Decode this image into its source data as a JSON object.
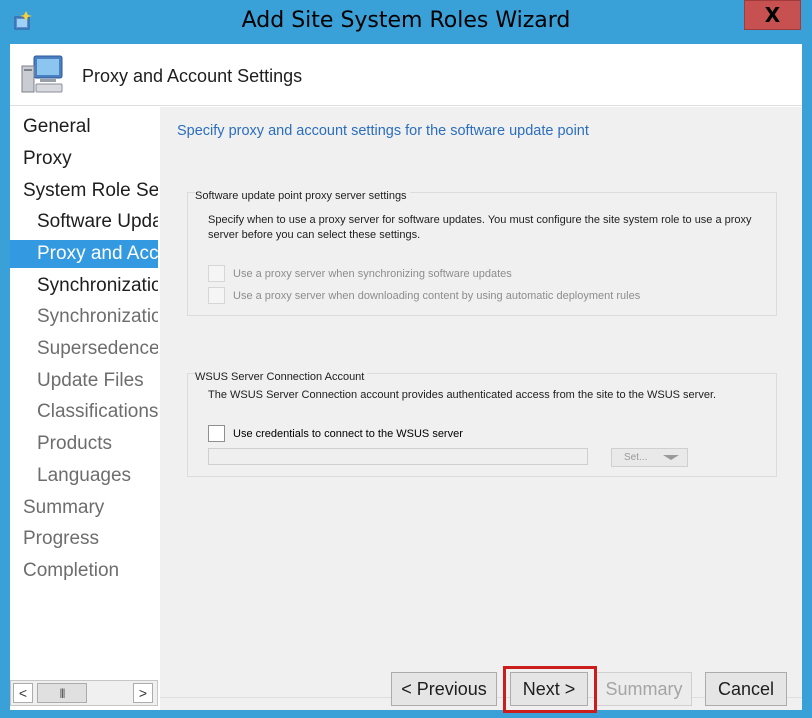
{
  "window": {
    "title": "Add Site System Roles Wizard",
    "close_label": "X"
  },
  "header": {
    "title": "Proxy and Account Settings",
    "icon": "computer-icon"
  },
  "nav": {
    "items": [
      {
        "label": "General",
        "level": 1,
        "state": "done"
      },
      {
        "label": "Proxy",
        "level": 1,
        "state": "done"
      },
      {
        "label": "System Role Sel",
        "level": 1,
        "state": "done"
      },
      {
        "label": "Software Upda",
        "level": 2,
        "state": "done"
      },
      {
        "label": "Proxy and Acc",
        "level": 2,
        "state": "current"
      },
      {
        "label": "Synchronizatio",
        "level": 2,
        "state": "next"
      },
      {
        "label": "Synchronizatio",
        "level": 2,
        "state": "future"
      },
      {
        "label": "Supersedence",
        "level": 2,
        "state": "future"
      },
      {
        "label": "Update Files",
        "level": 2,
        "state": "future"
      },
      {
        "label": "Classifications",
        "level": 2,
        "state": "future"
      },
      {
        "label": "Products",
        "level": 2,
        "state": "future"
      },
      {
        "label": "Languages",
        "level": 2,
        "state": "future"
      },
      {
        "label": "Summary",
        "level": 1,
        "state": "future"
      },
      {
        "label": "Progress",
        "level": 1,
        "state": "future"
      },
      {
        "label": "Completion",
        "level": 1,
        "state": "future"
      }
    ],
    "scroll_left": "<",
    "scroll_thumb": "|||",
    "scroll_right": ">"
  },
  "main": {
    "heading": "Specify proxy and account settings for the software update point",
    "proxy_group": {
      "title": "Software update point proxy server settings",
      "description": "Specify when to use a proxy server for software updates. You must configure the site system role to use a proxy server before you can select these settings.",
      "options": [
        {
          "label": "Use a proxy server when synchronizing software updates",
          "checked": false,
          "enabled": false
        },
        {
          "label": "Use a proxy server when downloading content by using automatic deployment rules",
          "checked": false,
          "enabled": false
        }
      ]
    },
    "wsus_group": {
      "title": "WSUS Server Connection Account",
      "description": "The WSUS Server Connection account provides authenticated access from the site to the WSUS server.",
      "credentials_label": "Use credentials to connect to the WSUS server",
      "credentials_checked": false,
      "account_value": "",
      "set_label": "Set..."
    }
  },
  "buttons": {
    "previous": "< Previous",
    "next": "Next >",
    "summary": "Summary",
    "cancel": "Cancel"
  },
  "colors": {
    "title_bar": "#3aa0d8",
    "accent": "#3399e0",
    "heading_text": "#2b6ebe",
    "highlight": "#cc1d1d"
  }
}
